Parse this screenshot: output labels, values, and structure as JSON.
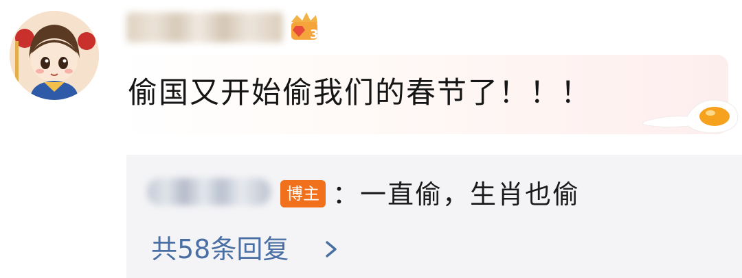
{
  "comment": {
    "text": "偷国又开始偷我们的春节了！！！",
    "level_badge": "3"
  },
  "reply": {
    "op_badge": "博主",
    "text": "：一直偷，生肖也偷",
    "count_label": "共58条回复"
  },
  "colors": {
    "op_badge": "#f0701c",
    "link": "#4a6fa5",
    "reply_bg": "#f4f4f6",
    "bubble_tint": "#fdeeee"
  }
}
